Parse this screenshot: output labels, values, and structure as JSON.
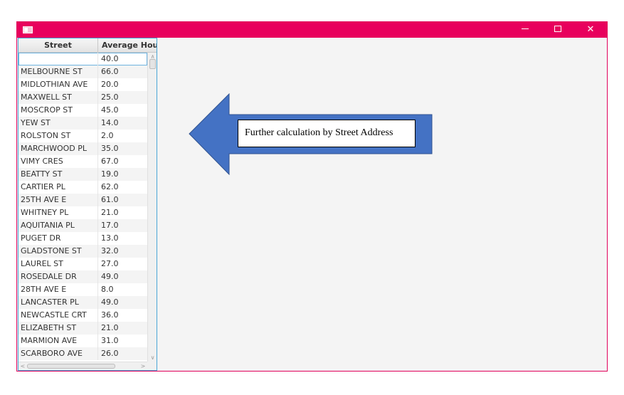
{
  "window": {
    "minimize_icon": "minimize-icon",
    "maximize_icon": "maximize-icon",
    "close_icon": "close-icon",
    "title_bar_color": "#e8005d"
  },
  "table": {
    "columns": [
      "Street",
      "Average Hous"
    ],
    "rows": [
      {
        "street": "",
        "avg": "40.0"
      },
      {
        "street": "MELBOURNE ST",
        "avg": "66.0"
      },
      {
        "street": "MIDLOTHIAN AVE",
        "avg": "20.0"
      },
      {
        "street": "MAXWELL ST",
        "avg": "25.0"
      },
      {
        "street": "MOSCROP ST",
        "avg": "45.0"
      },
      {
        "street": "YEW ST",
        "avg": "14.0"
      },
      {
        "street": "ROLSTON ST",
        "avg": "2.0"
      },
      {
        "street": "MARCHWOOD PL",
        "avg": "35.0"
      },
      {
        "street": "VIMY CRES",
        "avg": "67.0"
      },
      {
        "street": "BEATTY ST",
        "avg": "19.0"
      },
      {
        "street": "CARTIER PL",
        "avg": "62.0"
      },
      {
        "street": "25TH AVE E",
        "avg": "61.0"
      },
      {
        "street": "WHITNEY PL",
        "avg": "21.0"
      },
      {
        "street": "AQUITANIA PL",
        "avg": "17.0"
      },
      {
        "street": "PUGET DR",
        "avg": "13.0"
      },
      {
        "street": "GLADSTONE ST",
        "avg": "32.0"
      },
      {
        "street": "LAUREL ST",
        "avg": "27.0"
      },
      {
        "street": "ROSEDALE DR",
        "avg": "49.0"
      },
      {
        "street": "28TH AVE E",
        "avg": "8.0"
      },
      {
        "street": "LANCASTER PL",
        "avg": "49.0"
      },
      {
        "street": "NEWCASTLE CRT",
        "avg": "36.0"
      },
      {
        "street": "ELIZABETH ST",
        "avg": "21.0"
      },
      {
        "street": "MARMION AVE",
        "avg": "31.0"
      },
      {
        "street": "SCARBORO AVE",
        "avg": "26.0"
      }
    ]
  },
  "annotation": {
    "text": "Further calculation by Street Address",
    "arrow_color": "#4472c4"
  }
}
